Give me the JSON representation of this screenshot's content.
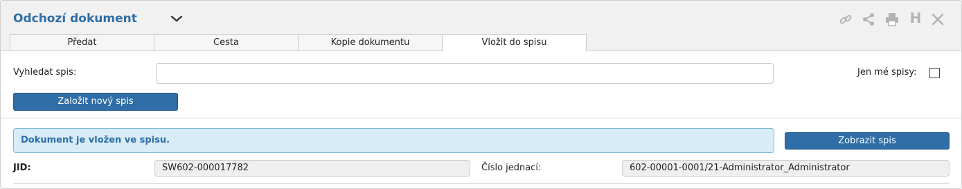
{
  "header": {
    "title": "Odchozí dokument",
    "icons": [
      "link-icon",
      "share-icon",
      "print-icon",
      "history-icon",
      "close-icon"
    ],
    "history_letter": "H"
  },
  "tabs": [
    {
      "label": "Předat",
      "active": false
    },
    {
      "label": "Cesta",
      "active": false
    },
    {
      "label": "Kopie dokumentu",
      "active": false
    },
    {
      "label": "Vložit do spisu",
      "active": true
    }
  ],
  "search": {
    "label": "Vyhledat spis:",
    "value": "",
    "placeholder": ""
  },
  "only_mine": {
    "label": "Jen mé spisy:",
    "checked": false
  },
  "new_file_button": "Založit nový spis",
  "info_message": "Dokument je vložen ve spisu.",
  "show_file_button": "Zobrazit spis",
  "jid": {
    "label": "JID:",
    "value": "SW602-000017782"
  },
  "reference_number": {
    "label": "Číslo jednací:",
    "value": "602-00001-0001/21-Administrator_Administrator"
  },
  "colors": {
    "accent": "#2f6ea7",
    "info_bg": "#d8ecf8",
    "info_border": "#7eb7d8"
  }
}
